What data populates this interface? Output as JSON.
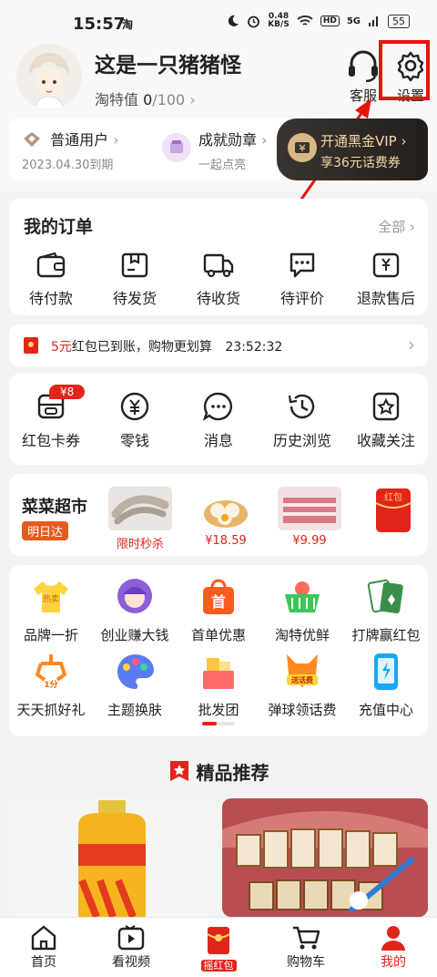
{
  "status": {
    "time": "15:57",
    "carrier_icon": "淘",
    "speed_value": "0.48",
    "speed_unit": "KB/S",
    "network": "5G",
    "battery": "55"
  },
  "profile": {
    "username": "这是一只猪猪怪",
    "taote_label": "淘特值",
    "taote_value": "0",
    "taote_max": "/100",
    "customer_service": "客服",
    "settings": "设置"
  },
  "infobar": {
    "user_level": "普通用户",
    "user_expire": "2023.04.30到期",
    "badge_title": "成就勋章",
    "badge_sub": "一起点亮",
    "vip_title": "开通黑金VIP",
    "vip_sub": "享36元话费券"
  },
  "orders": {
    "title": "我的订单",
    "all": "全部",
    "items": [
      "待付款",
      "待发货",
      "待收货",
      "待评价",
      "退款售后"
    ]
  },
  "notice": {
    "amount": "5元",
    "text": "红包已到账，购物更划算",
    "countdown": "23:52:32"
  },
  "wallet": {
    "badge": "¥8",
    "items": [
      "红包卡券",
      "零钱",
      "消息",
      "历史浏览",
      "收藏关注"
    ]
  },
  "market": {
    "title": "菜菜超市",
    "tag": "明日达",
    "items": [
      {
        "label": "限时秒杀"
      },
      {
        "label": "¥18.59"
      },
      {
        "label": "¥9.99"
      },
      {
        "label": "红包"
      }
    ]
  },
  "services": {
    "row1": [
      "品牌一折",
      "创业赚大钱",
      "首单优惠",
      "淘特优鲜",
      "打牌赢红包"
    ],
    "row2": [
      "天天抓好礼",
      "主题换肤",
      "批发团",
      "弹球领话费",
      "充值中心"
    ],
    "icon_texts": {
      "hot": "热卖",
      "first": "首",
      "one": "1分",
      "fee": "送话费"
    }
  },
  "recommend": {
    "title": "精品推荐"
  },
  "nav": {
    "items": [
      "首页",
      "看视频",
      "摇红包",
      "购物车",
      "我的"
    ],
    "active": "我的"
  },
  "colors": {
    "accent": "#e1251b",
    "vip_gold": "#f3d6a5"
  }
}
